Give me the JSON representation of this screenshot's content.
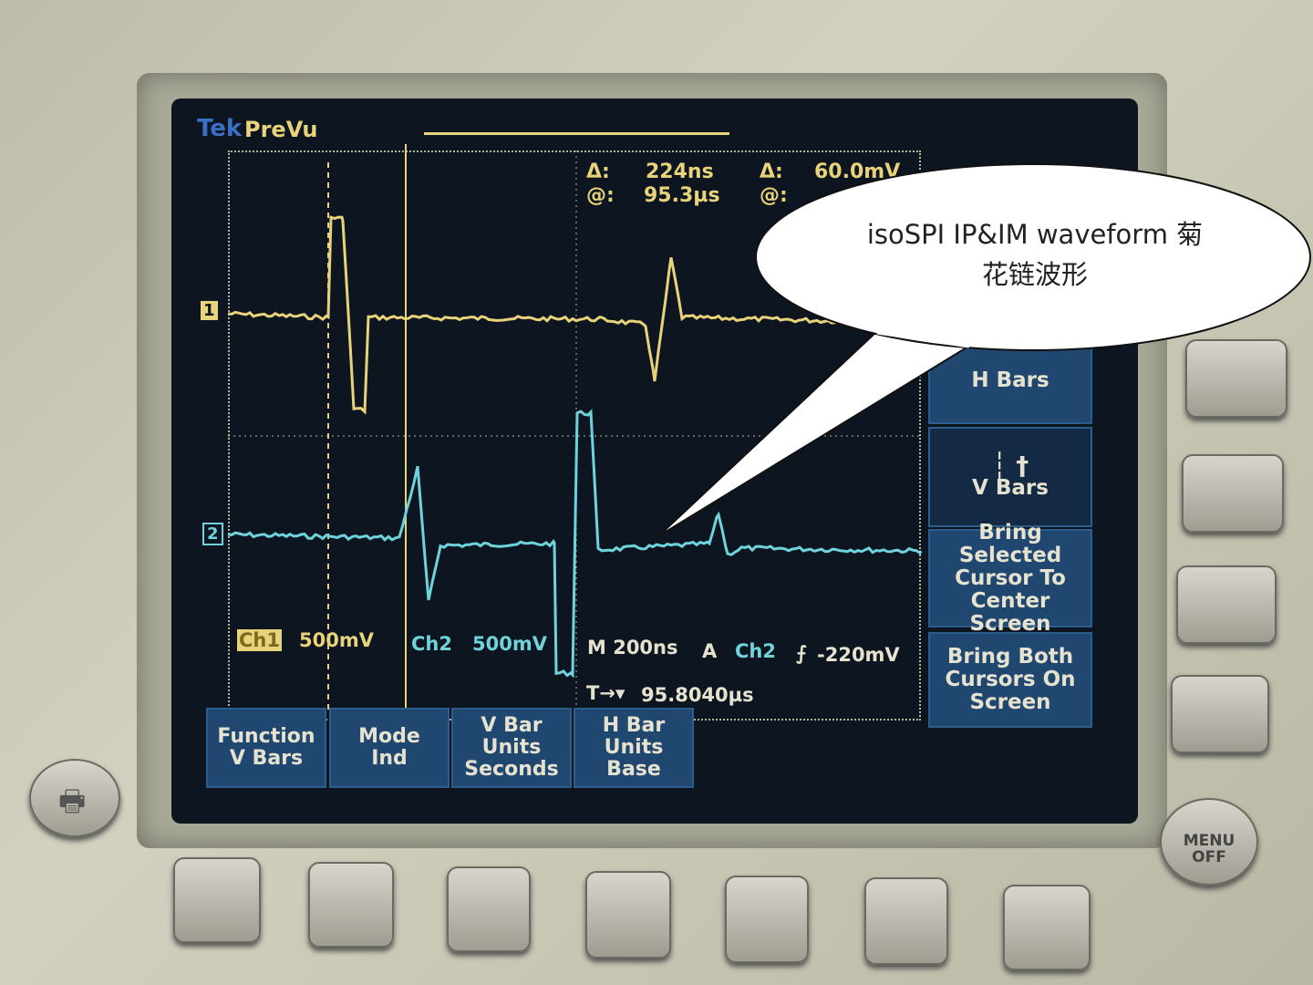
{
  "scope": {
    "brand": "Tek",
    "mode": "PreVu",
    "cursor_readout": {
      "delta_time": "224ns",
      "at_time": "95.3µs",
      "delta_volt": "60.0mV",
      "at_volt_label": "@:",
      "delta_label": "Δ:"
    },
    "ch1": {
      "label": "Ch1",
      "scale": "500mV",
      "marker": "1",
      "color": "#e8d27a"
    },
    "ch2": {
      "label": "Ch2",
      "scale": "500mV",
      "marker": "2",
      "color": "#6fd3dc"
    },
    "timebase": "M 200ns",
    "trigger": {
      "mode": "A",
      "source": "Ch2",
      "level": "-220mV",
      "position": "95.8040µs"
    },
    "side_menu": [
      "H Bars",
      "V Bars",
      "Bring Selected Cursor To Center Screen",
      "Bring Both Cursors On Screen"
    ],
    "bottom_menu": [
      {
        "l1": "Function",
        "l2": "V Bars"
      },
      {
        "l1": "Mode",
        "l2": "Ind"
      },
      {
        "l1": "V Bar",
        "l2": "Units",
        "l3": "Seconds"
      },
      {
        "l1": "H Bar",
        "l2": "Units",
        "l3": "Base"
      }
    ],
    "menu_off": {
      "l1": "MENU",
      "l2": "OFF"
    }
  },
  "callout": {
    "line1": "isoSPI IP&IM waveform 菊",
    "line2": "花链波形"
  }
}
